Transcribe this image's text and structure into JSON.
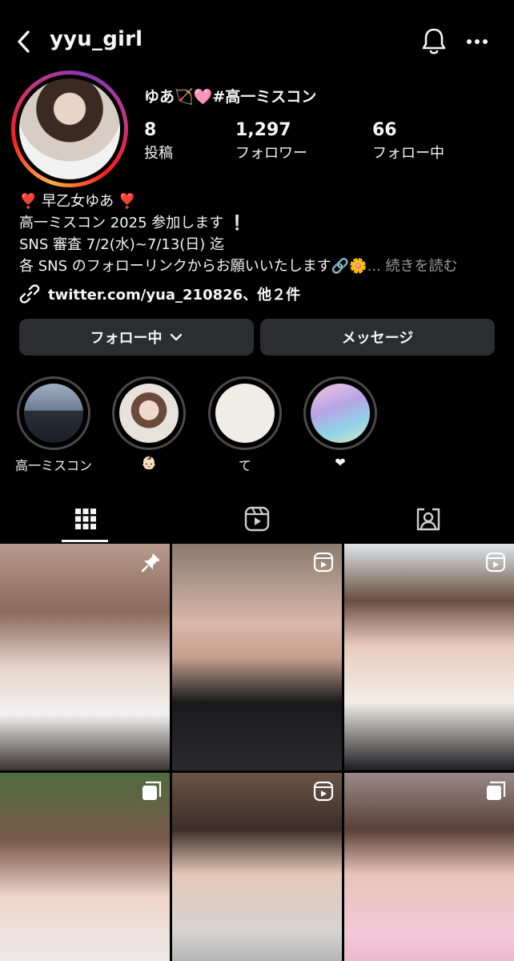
{
  "header": {
    "username": "yyu_girl",
    "back_icon": "chevron-left-icon",
    "bell_icon": "bell-icon",
    "more_icon": "more-horizontal-icon"
  },
  "profile": {
    "display_name": "ゆあ🏹🩷#高一ミスコン",
    "stats": [
      {
        "value": "8",
        "label": "投稿"
      },
      {
        "value": "1,297",
        "label": "フォロワー"
      },
      {
        "value": "66",
        "label": "フォロー中"
      }
    ],
    "bio": [
      "❣️ 早乙女ゆあ ❣️",
      "高一ミスコン 2025 参加します ❕",
      "SNS 審査 7/2(水)~7/13(日) 迄",
      "各 SNS のフォローリンクからお願いいたします🔗🌼"
    ],
    "bio_more": "... 続きを読む",
    "link_text": "twitter.com/yua_210826、他２件"
  },
  "buttons": {
    "follow_label": "フォロー中",
    "message_label": "メッセージ"
  },
  "highlights": [
    {
      "caption": "高一ミスコン"
    },
    {
      "caption": "👶🏻"
    },
    {
      "caption": "て"
    },
    {
      "caption": "❤"
    }
  ],
  "tabs": [
    {
      "icon": "grid-icon",
      "active": true
    },
    {
      "icon": "reels-icon",
      "active": false
    },
    {
      "icon": "tagged-icon",
      "active": false
    }
  ],
  "posts": [
    {
      "badge": "pin-icon"
    },
    {
      "badge": "reel-icon"
    },
    {
      "badge": "reel-icon"
    },
    {
      "badge": "carousel-icon"
    },
    {
      "badge": "reel-icon"
    },
    {
      "badge": "carousel-icon"
    }
  ],
  "colors": {
    "background": "#000000",
    "button_bg": "#2b2d31",
    "muted_text": "#9a9a9a"
  }
}
